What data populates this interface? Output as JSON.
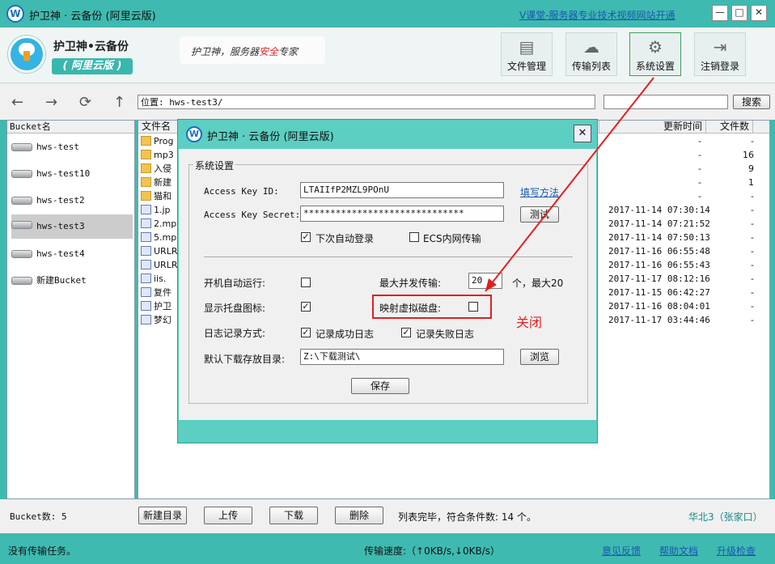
{
  "window": {
    "title": "护卫神 · 云备份 (阿里云版)",
    "promo_link": "V课堂-服务器专业技术视频网站开通",
    "controls": {
      "minimize": "—",
      "maximize": "□",
      "close": "✕"
    },
    "icon_letter": "W"
  },
  "header": {
    "app_name": "护卫神•云备份",
    "edition": "( 阿里云版 )",
    "slogan_pre": "护卫神，服务器",
    "slogan_red": "安全",
    "slogan_post": "专家",
    "nav": [
      {
        "label": "文件管理",
        "icon": "document-icon"
      },
      {
        "label": "传输列表",
        "icon": "cloud-upload-icon"
      },
      {
        "label": "系统设置",
        "icon": "gear-icon"
      },
      {
        "label": "注销登录",
        "icon": "logout-icon"
      }
    ]
  },
  "toolbar": {
    "location": "位置: hws-test3/",
    "search_label": "搜索"
  },
  "buckets": {
    "header": "Bucket名",
    "items": [
      "hws-test",
      "hws-test10",
      "hws-test2",
      "hws-test3",
      "hws-test4"
    ],
    "selected": "hws-test3",
    "new_bucket": "新建Bucket"
  },
  "files": {
    "columns": {
      "name": "文件名",
      "updated": "更新时间",
      "count": "文件数"
    },
    "names": [
      "Prog",
      "mp3",
      "入侵",
      "新建",
      "猫和",
      "1.jp",
      "2.mp",
      "5.mp",
      "URLR",
      "URLR",
      "iis.",
      "复件",
      "护卫",
      "梦幻"
    ],
    "rows": [
      {
        "time": "",
        "dash": "-",
        "count": "-"
      },
      {
        "time": "",
        "dash": "-",
        "count": "16"
      },
      {
        "time": "",
        "dash": "-",
        "count": "9"
      },
      {
        "time": "",
        "dash": "-",
        "count": "1"
      },
      {
        "time": "",
        "dash": "-",
        "count": "-"
      },
      {
        "time": "2017-11-14 07:30:14",
        "dash": "",
        "count": "-"
      },
      {
        "time": "2017-11-14 07:21:52",
        "dash": "",
        "count": "-"
      },
      {
        "time": "2017-11-14 07:50:13",
        "dash": "",
        "count": "-"
      },
      {
        "time": "2017-11-16 06:55:48",
        "dash": "",
        "count": "-"
      },
      {
        "time": "2017-11-16 06:55:43",
        "dash": "",
        "count": "-"
      },
      {
        "time": "2017-11-17 08:12:16",
        "dash": "",
        "count": "-"
      },
      {
        "time": "2017-11-15 06:42:27",
        "dash": "",
        "count": "-"
      },
      {
        "time": "2017-11-16 08:04:01",
        "dash": "",
        "count": "-"
      },
      {
        "time": "2017-11-17 03:44:46",
        "dash": "",
        "count": "-"
      }
    ]
  },
  "bottom": {
    "bucket_count": "Bucket数: 5",
    "buttons": {
      "new_dir": "新建目录",
      "upload": "上传",
      "download": "下载",
      "delete": "删除"
    },
    "list_status": "列表完毕，符合条件数: 14 个。",
    "region": "华北3（张家口）"
  },
  "statusbar": {
    "tasks": "没有传输任务。",
    "speed": "传输速度:（↑0KB/s,↓0KB/s）",
    "links": [
      "意见反馈",
      "帮助文档",
      "升级检查"
    ]
  },
  "dialog": {
    "title": "护卫神 · 云备份 (阿里云版)",
    "icon_letter": "W",
    "close": "✕",
    "group_title": "系统设置",
    "access_key_id_label": "Access Key ID:",
    "access_key_id": "LTAIIfP2MZL9POnU",
    "howto_link": "填写方法",
    "access_key_secret_label": "Access Key Secret:",
    "access_key_secret": "******************************",
    "test_button": "测试",
    "auto_login_label": "下次自动登录",
    "auto_login_checked": "✓",
    "ecs_label": "ECS内网传输",
    "autostart_label": "开机自动运行:",
    "max_concurrent_label": "最大并发传输:",
    "max_concurrent_value": "20",
    "max_concurrent_suffix": "个，最大20",
    "tray_icon_label": "显示托盘图标:",
    "tray_icon_checked": "✓",
    "virtual_disk_label": "映射虚拟磁盘:",
    "log_mode_label": "日志记录方式:",
    "log_success_label": "记录成功日志",
    "log_success_checked": "✓",
    "log_fail_label": "记录失败日志",
    "log_fail_checked": "✓",
    "download_dir_label": "默认下载存放目录:",
    "download_dir": "Z:\\下载测试\\",
    "browse_button": "浏览",
    "save_button": "保存"
  },
  "annotation": {
    "text": "关闭",
    "color": "#e02020"
  }
}
